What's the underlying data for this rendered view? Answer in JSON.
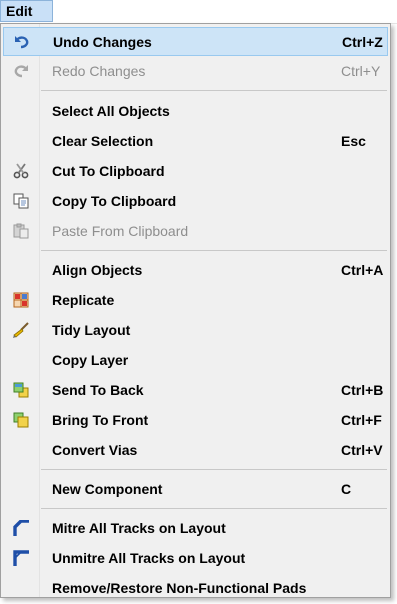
{
  "menubar": {
    "edit_label": "Edit"
  },
  "menu": {
    "undo": {
      "label": "Undo Changes",
      "shortcut": "Ctrl+Z",
      "icon": "undo-icon"
    },
    "redo": {
      "label": "Redo Changes",
      "shortcut": "Ctrl+Y",
      "icon": "redo-icon"
    },
    "select_all": {
      "label": "Select All Objects"
    },
    "clear_selection": {
      "label": "Clear Selection",
      "shortcut": "Esc"
    },
    "cut": {
      "label": "Cut To Clipboard",
      "icon": "scissors-icon"
    },
    "copy": {
      "label": "Copy To Clipboard",
      "icon": "copy-icon"
    },
    "paste": {
      "label": "Paste From Clipboard",
      "icon": "paste-icon"
    },
    "align": {
      "label": "Align Objects",
      "shortcut": "Ctrl+A"
    },
    "replicate": {
      "label": "Replicate",
      "icon": "replicate-icon"
    },
    "tidy": {
      "label": "Tidy Layout",
      "icon": "brush-icon"
    },
    "copy_layer": {
      "label": "Copy Layer"
    },
    "send_back": {
      "label": "Send To Back",
      "shortcut": "Ctrl+B",
      "icon": "send-to-back-icon"
    },
    "bring_front": {
      "label": "Bring To Front",
      "shortcut": "Ctrl+F",
      "icon": "bring-to-front-icon"
    },
    "convert_vias": {
      "label": "Convert Vias",
      "shortcut": "Ctrl+V"
    },
    "new_component": {
      "label": "New Component",
      "shortcut": "C"
    },
    "mitre": {
      "label": "Mitre All Tracks on Layout",
      "icon": "mitre-icon"
    },
    "unmitre": {
      "label": "Unmitre All Tracks on Layout",
      "icon": "unmitre-icon"
    },
    "remove_pads": {
      "label": "Remove/Restore Non-Functional Pads"
    }
  },
  "colors": {
    "highlight": "#cde4f7",
    "highlight_border": "#99c9ef",
    "disabled_text": "#8e8e8e",
    "menu_bg": "#f0f0f0"
  }
}
